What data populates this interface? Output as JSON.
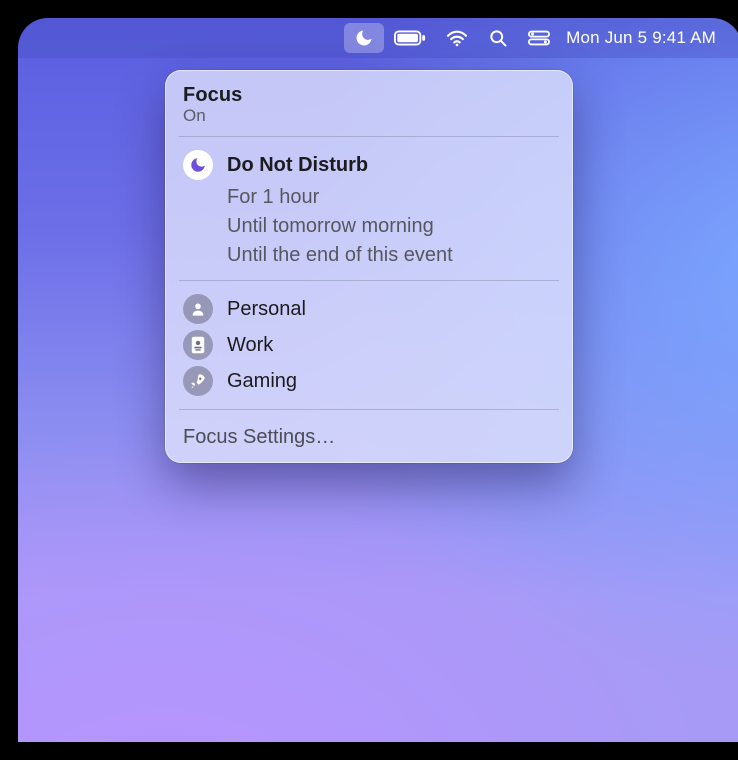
{
  "menubar": {
    "date_time": "Mon Jun 5  9:41 AM"
  },
  "popover": {
    "title": "Focus",
    "status": "On",
    "active": {
      "label": "Do Not Disturb",
      "options": [
        "For 1 hour",
        "Until tomorrow morning",
        "Until the end of this event"
      ]
    },
    "modes": [
      {
        "label": "Personal"
      },
      {
        "label": "Work"
      },
      {
        "label": "Gaming"
      }
    ],
    "settings": "Focus Settings…"
  }
}
